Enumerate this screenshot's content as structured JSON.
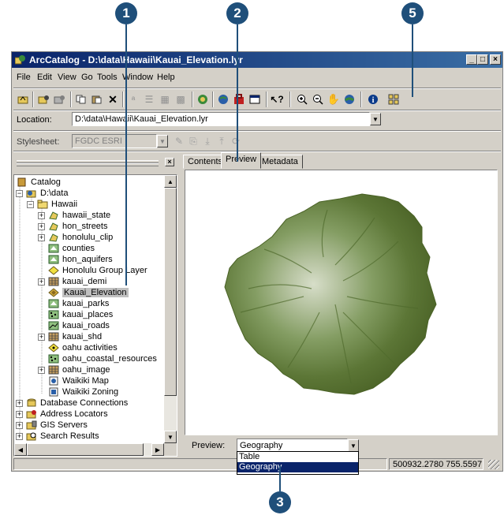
{
  "callouts": [
    "1",
    "2",
    "5",
    "3"
  ],
  "window": {
    "title": "ArcCatalog - D:\\data\\Hawaii\\Kauai_Elevation.lyr",
    "minimize": "_",
    "restore": "□",
    "close": "×"
  },
  "menu": {
    "file": "File",
    "edit": "Edit",
    "view": "View",
    "go": "Go",
    "tools": "Tools",
    "window": "Window",
    "help": "Help"
  },
  "location": {
    "label": "Location:",
    "value": "D:\\data\\Hawaii\\Kauai_Elevation.lyr"
  },
  "stylesheet": {
    "label": "Stylesheet:",
    "value": "FGDC ESRI"
  },
  "tree": {
    "items": [
      {
        "label": "Catalog",
        "icon": "catalog-icon"
      },
      {
        "label": "D:\\data",
        "icon": "folder-connection-icon"
      },
      {
        "label": "Hawaii",
        "icon": "folder-icon"
      },
      {
        "label": "hawaii_state",
        "icon": "coverage-icon"
      },
      {
        "label": "hon_streets",
        "icon": "coverage-icon"
      },
      {
        "label": "honolulu_clip",
        "icon": "coverage-icon"
      },
      {
        "label": "counties",
        "icon": "shapefile-polygon-icon"
      },
      {
        "label": "hon_aquifers",
        "icon": "shapefile-polygon-icon"
      },
      {
        "label": "Honolulu Group Layer",
        "icon": "layer-icon"
      },
      {
        "label": "kauai_demi",
        "icon": "grid-icon"
      },
      {
        "label": "Kauai_Elevation",
        "icon": "layer-icon"
      },
      {
        "label": "kauai_parks",
        "icon": "shapefile-polygon-icon"
      },
      {
        "label": "kauai_places",
        "icon": "shapefile-point-icon"
      },
      {
        "label": "kauai_roads",
        "icon": "shapefile-line-icon"
      },
      {
        "label": "kauai_shd",
        "icon": "grid-icon"
      },
      {
        "label": "oahu activities",
        "icon": "layer-icon"
      },
      {
        "label": "oahu_coastal_resources",
        "icon": "shapefile-point-icon"
      },
      {
        "label": "oahu_image",
        "icon": "grid-icon"
      },
      {
        "label": "Waikiki Map",
        "icon": "map-document-icon"
      },
      {
        "label": "Waikiki Zoning",
        "icon": "map-document-icon"
      },
      {
        "label": "Database Connections",
        "icon": "database-icon"
      },
      {
        "label": "Address Locators",
        "icon": "address-locator-icon"
      },
      {
        "label": "GIS Servers",
        "icon": "gis-server-icon"
      },
      {
        "label": "Search Results",
        "icon": "search-results-icon"
      }
    ]
  },
  "tabs": {
    "contents": "Contents",
    "preview": "Preview",
    "metadata": "Metadata"
  },
  "preview": {
    "label": "Preview:",
    "value": "Geography",
    "options": [
      "Table",
      "Geography"
    ],
    "selected": "Geography"
  },
  "status": {
    "coords": "500932.2780  755.5597"
  },
  "colors": {
    "accent": "#1f4f7a",
    "titlebar": "#0a246a",
    "terrain_dark": "#4f6a2c",
    "terrain_light": "#cfd8bf"
  }
}
